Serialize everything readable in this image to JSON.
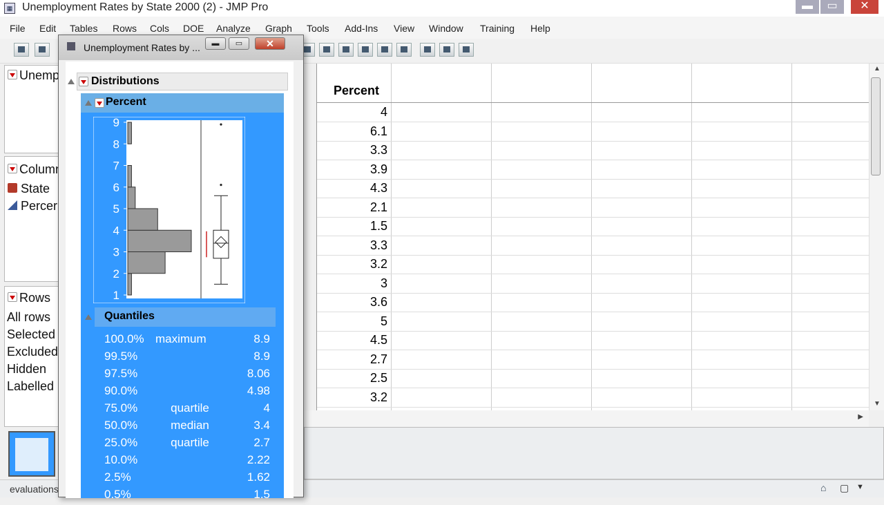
{
  "window": {
    "title": "Unemployment Rates by State 2000 (2) - JMP Pro"
  },
  "menu": [
    "File",
    "Edit",
    "Tables",
    "Rows",
    "Cols",
    "DOE",
    "Analyze",
    "Graph",
    "Tools",
    "Add-Ins",
    "View",
    "Window",
    "Training",
    "Help"
  ],
  "left_panels": {
    "table_name": "Unemp",
    "columns_title": "Column",
    "columns": [
      {
        "name": "State"
      },
      {
        "name": "Percer"
      }
    ],
    "rows_title": "Rows",
    "row_states": [
      "All rows",
      "Selected",
      "Excluded",
      "Hidden",
      "Labelled"
    ]
  },
  "grid": {
    "column_header": "Percent",
    "values": [
      "4",
      "6.1",
      "3.3",
      "3.9",
      "4.3",
      "2.1",
      "1.5",
      "3.3",
      "3.2",
      "3",
      "3.6",
      "5",
      "4.5",
      "2.7",
      "2.5",
      "3.2"
    ]
  },
  "status": {
    "text": "evaluations"
  },
  "dist_window": {
    "title": "Unemployment Rates by ...",
    "distributions_label": "Distributions",
    "variable_label": "Percent",
    "quantiles_label": "Quantiles",
    "quantiles": [
      {
        "pct": "100.0%",
        "label": "maximum",
        "value": "8.9"
      },
      {
        "pct": "99.5%",
        "label": "",
        "value": "8.9"
      },
      {
        "pct": "97.5%",
        "label": "",
        "value": "8.06"
      },
      {
        "pct": "90.0%",
        "label": "",
        "value": "4.98"
      },
      {
        "pct": "75.0%",
        "label": "quartile",
        "value": "4"
      },
      {
        "pct": "50.0%",
        "label": "median",
        "value": "3.4"
      },
      {
        "pct": "25.0%",
        "label": "quartile",
        "value": "2.7"
      },
      {
        "pct": "10.0%",
        "label": "",
        "value": "2.22"
      },
      {
        "pct": "2.5%",
        "label": "",
        "value": "1.62"
      },
      {
        "pct": "0.5%",
        "label": "",
        "value": "1.5"
      }
    ]
  },
  "chart_data": {
    "type": "bar",
    "orientation": "horizontal",
    "y_ticks": [
      "1",
      "2",
      "3",
      "4",
      "5",
      "6",
      "7",
      "8",
      "9"
    ],
    "ylim": [
      1,
      9
    ],
    "bins": [
      {
        "from": 1,
        "to": 2,
        "count": 1
      },
      {
        "from": 2,
        "to": 3,
        "count": 10
      },
      {
        "from": 3,
        "to": 4,
        "count": 17
      },
      {
        "from": 4,
        "to": 5,
        "count": 8
      },
      {
        "from": 5,
        "to": 6,
        "count": 2
      },
      {
        "from": 6,
        "to": 7,
        "count": 1
      },
      {
        "from": 8,
        "to": 9,
        "count": 1
      }
    ],
    "boxplot": {
      "min": 1.5,
      "q1": 2.7,
      "median": 3.4,
      "q3": 4,
      "whisker_high": 5.6,
      "outliers": [
        6.1,
        8.9
      ],
      "mean": 3.45
    },
    "colors": {
      "bar": "#9a9a9a",
      "selection": "#3399ff"
    }
  }
}
